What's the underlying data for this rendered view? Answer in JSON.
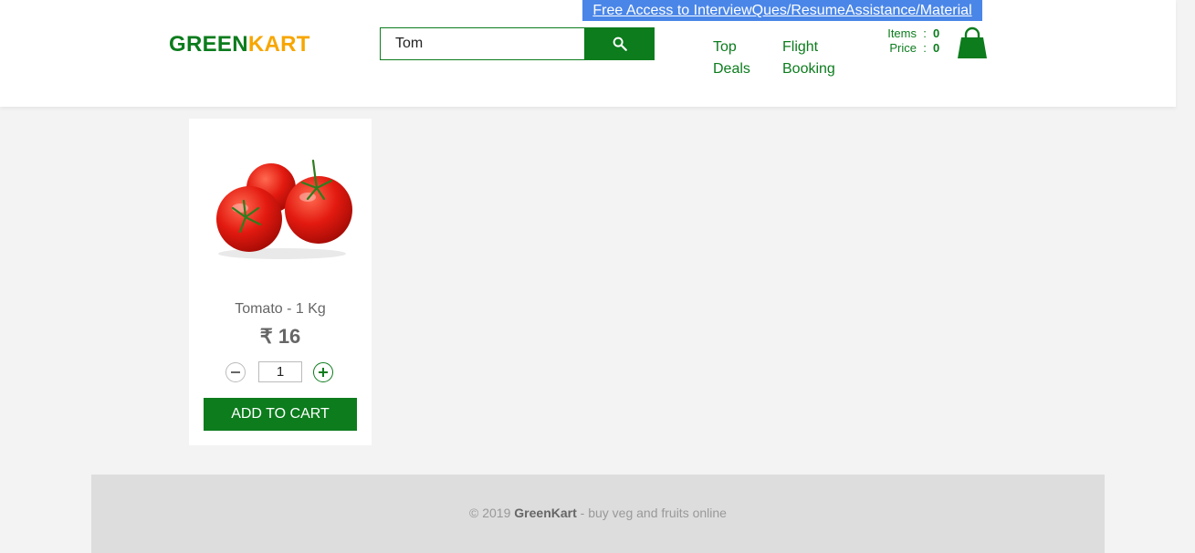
{
  "header": {
    "promo_link": "Free Access to InterviewQues/ResumeAssistance/Material",
    "logo_part1": "GREEN",
    "logo_part2": "KART",
    "search": {
      "value": "Tom",
      "icon": "search-icon"
    },
    "nav": {
      "top_deals_line1": "Top",
      "top_deals_line2": "Deals",
      "flight_booking_line1": "Flight",
      "flight_booking_line2": "Booking"
    },
    "cart": {
      "items_label": "Items",
      "items_value": "0",
      "price_label": "Price",
      "price_value": "0",
      "separator": ":",
      "icon": "shopping-bag-icon"
    }
  },
  "products": [
    {
      "name": "Tomato - 1 Kg",
      "price": "₹ 16",
      "quantity": "1",
      "add_label": "ADD TO CART"
    }
  ],
  "footer": {
    "prefix": "© 2019 ",
    "brand": "GreenKart",
    "suffix": " - buy veg and fruits online"
  },
  "colors": {
    "brand_green": "#0c7c1d",
    "brand_orange": "#f7a600",
    "promo_blue": "#4a86e8"
  }
}
